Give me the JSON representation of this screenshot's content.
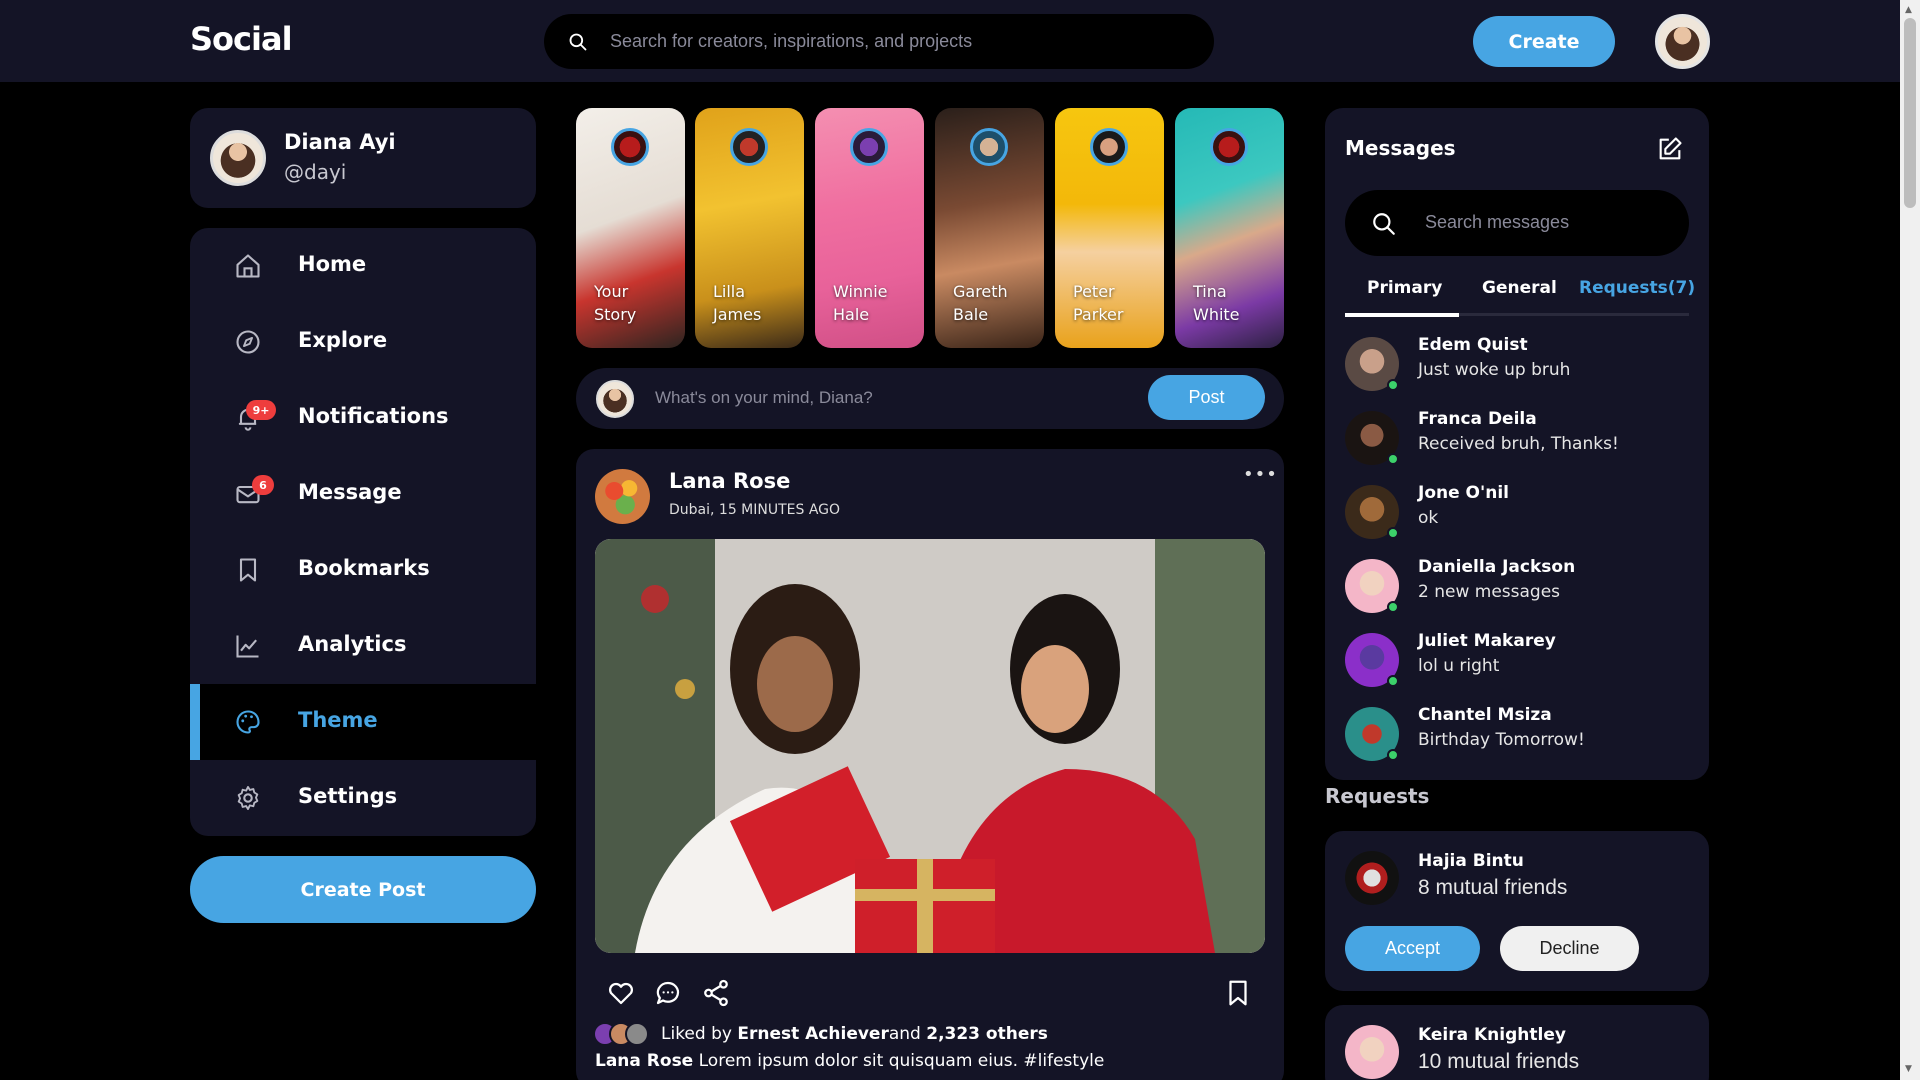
{
  "app": {
    "logo": "Social"
  },
  "header": {
    "search_placeholder": "Search for creators, inspirations, and projects",
    "create_label": "Create"
  },
  "profile": {
    "name": "Diana Ayi",
    "handle": "@dayi"
  },
  "sidebar": {
    "items": [
      {
        "label": "Home",
        "icon": "home-icon"
      },
      {
        "label": "Explore",
        "icon": "compass-icon"
      },
      {
        "label": "Notifications",
        "icon": "bell-icon",
        "badge": "9+"
      },
      {
        "label": "Message",
        "icon": "mail-icon",
        "badge": "6"
      },
      {
        "label": "Bookmarks",
        "icon": "bookmark-icon"
      },
      {
        "label": "Analytics",
        "icon": "chart-icon"
      },
      {
        "label": "Theme",
        "icon": "palette-icon",
        "active": true
      },
      {
        "label": "Settings",
        "icon": "gear-icon"
      }
    ],
    "create_post_label": "Create Post"
  },
  "stories": [
    {
      "line1": "Your",
      "line2": "Story"
    },
    {
      "line1": "Lilla",
      "line2": "James"
    },
    {
      "line1": "Winnie",
      "line2": "Hale"
    },
    {
      "line1": "Gareth",
      "line2": "Bale"
    },
    {
      "line1": "Peter",
      "line2": "Parker"
    },
    {
      "line1": "Tina",
      "line2": "White"
    }
  ],
  "composer": {
    "placeholder": "What's on your mind, Diana?",
    "post_label": "Post"
  },
  "feed": {
    "author": "Lana Rose",
    "meta": "Dubai, 15 MINUTES AGO",
    "liked_by_prefix": "Liked by",
    "liked_by_name": "Ernest Achiever",
    "liked_by_rest_and": "and",
    "liked_by_count": "2,323 others",
    "caption_author": "Lana Rose",
    "caption_text": "Lorem ipsum dolor sit quisquam eius. #lifestyle"
  },
  "messages": {
    "title": "Messages",
    "search_placeholder": "Search messages",
    "tabs": [
      "Primary",
      "General",
      "Requests(7)"
    ],
    "items": [
      {
        "name": "Edem Quist",
        "text": "Just woke up bruh"
      },
      {
        "name": "Franca Deila",
        "text": "Received bruh, Thanks!"
      },
      {
        "name": "Jone O'nil",
        "text": "ok"
      },
      {
        "name": "Daniella Jackson",
        "text": "2 new messages"
      },
      {
        "name": "Juliet Makarey",
        "text": "lol u right"
      },
      {
        "name": "Chantel Msiza",
        "text": "Birthday Tomorrow!"
      }
    ]
  },
  "requests": {
    "title": "Requests",
    "items": [
      {
        "name": "Hajia Bintu",
        "mutual": "8 mutual friends",
        "accept": "Accept",
        "decline": "Decline"
      },
      {
        "name": "Keira Knightley",
        "mutual": "10 mutual friends"
      }
    ]
  },
  "colors": {
    "accent": "#47a5e3",
    "card": "#141426",
    "online": "#3cd16a",
    "badge": "#ee3d3d"
  }
}
